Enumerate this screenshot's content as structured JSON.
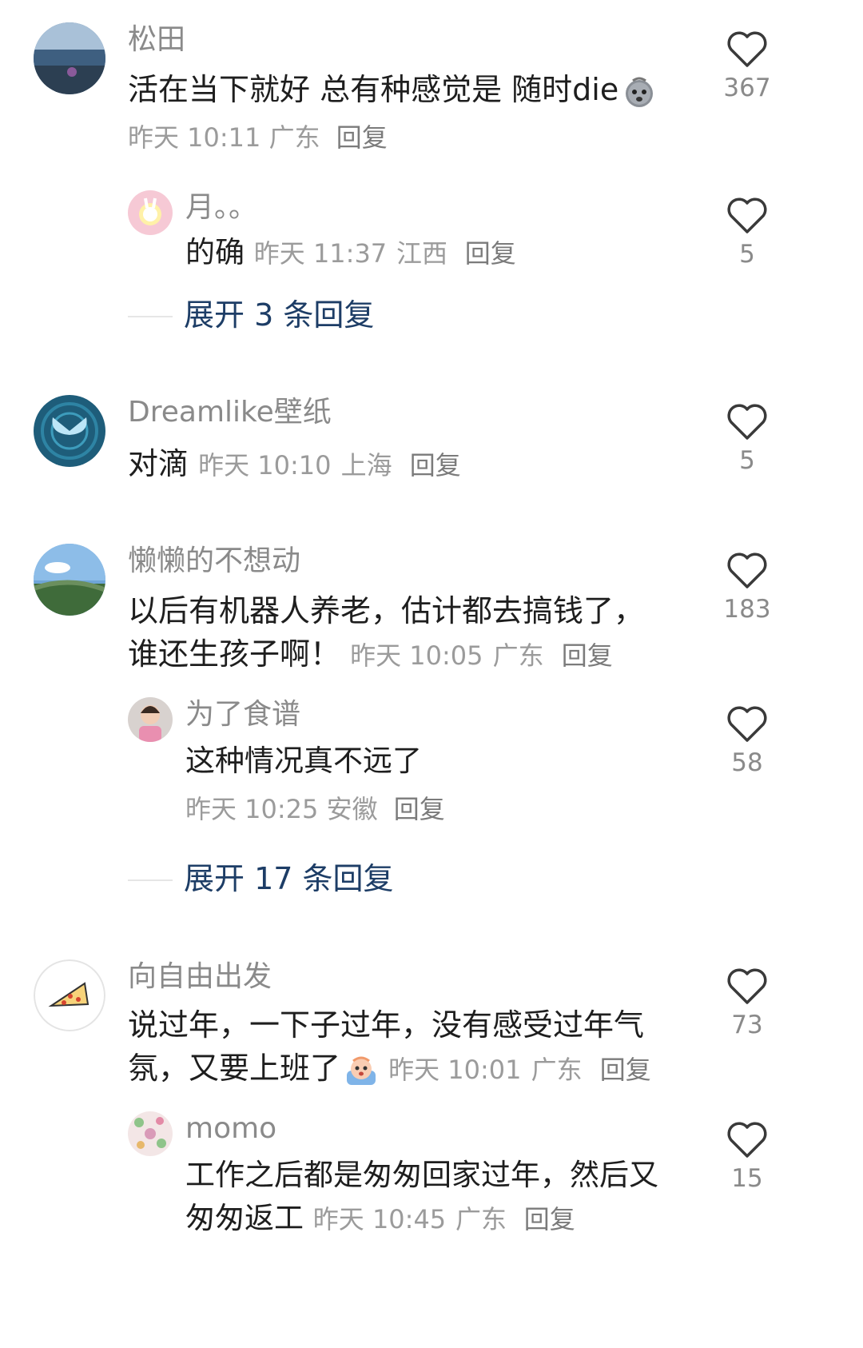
{
  "comments": [
    {
      "name": "松田",
      "text": "活在当下就好 总有种感觉是 随时die",
      "emoji": "ghost-sad-emoji",
      "time": "昨天 10:11",
      "location": "广东",
      "reply": "回复",
      "likes": "367",
      "replies": [
        {
          "name": "月。。",
          "text": "的确",
          "time": "昨天 11:37",
          "location": "江西",
          "reply": "回复",
          "likes": "5"
        }
      ],
      "expand": "展开 3 条回复"
    },
    {
      "name": "Dreamlike壁纸",
      "text": "对滴",
      "time": "昨天 10:10",
      "location": "上海",
      "reply": "回复",
      "likes": "5"
    },
    {
      "name": "懒懒的不想动",
      "text_line1": "以后有机器人养老，估计都去搞钱了，",
      "text_line2": "谁还生孩子啊！",
      "time": "昨天 10:05",
      "location": "广东",
      "reply": "回复",
      "likes": "183",
      "replies": [
        {
          "name": "为了食谱",
          "text": "这种情况真不远了",
          "time": "昨天 10:25",
          "location": "安徽",
          "reply": "回复",
          "likes": "58"
        }
      ],
      "expand": "展开 17 条回复"
    },
    {
      "name": "向自由出发",
      "text_line1": "说过年，一下子过年，没有感受过年气",
      "text_line2": "氛，又要上班了",
      "emoji": "crying-face-emoji",
      "time": "昨天 10:01",
      "location": "广东",
      "reply": "回复",
      "likes": "73",
      "replies": [
        {
          "name": "momo",
          "text_line1": "工作之后都是匆匆回家过年，然后又",
          "text_line2": "匆匆返工",
          "time": "昨天 10:45",
          "location": "广东",
          "reply": "回复",
          "likes": "15"
        }
      ]
    }
  ],
  "colors": {
    "username": "#8a8a8a",
    "text": "#1e1e1e",
    "meta": "#9b9b9b",
    "expand": "#1d3d66",
    "heart": "#3a3a3a"
  },
  "icons": {
    "like": "heart-outline-icon"
  }
}
